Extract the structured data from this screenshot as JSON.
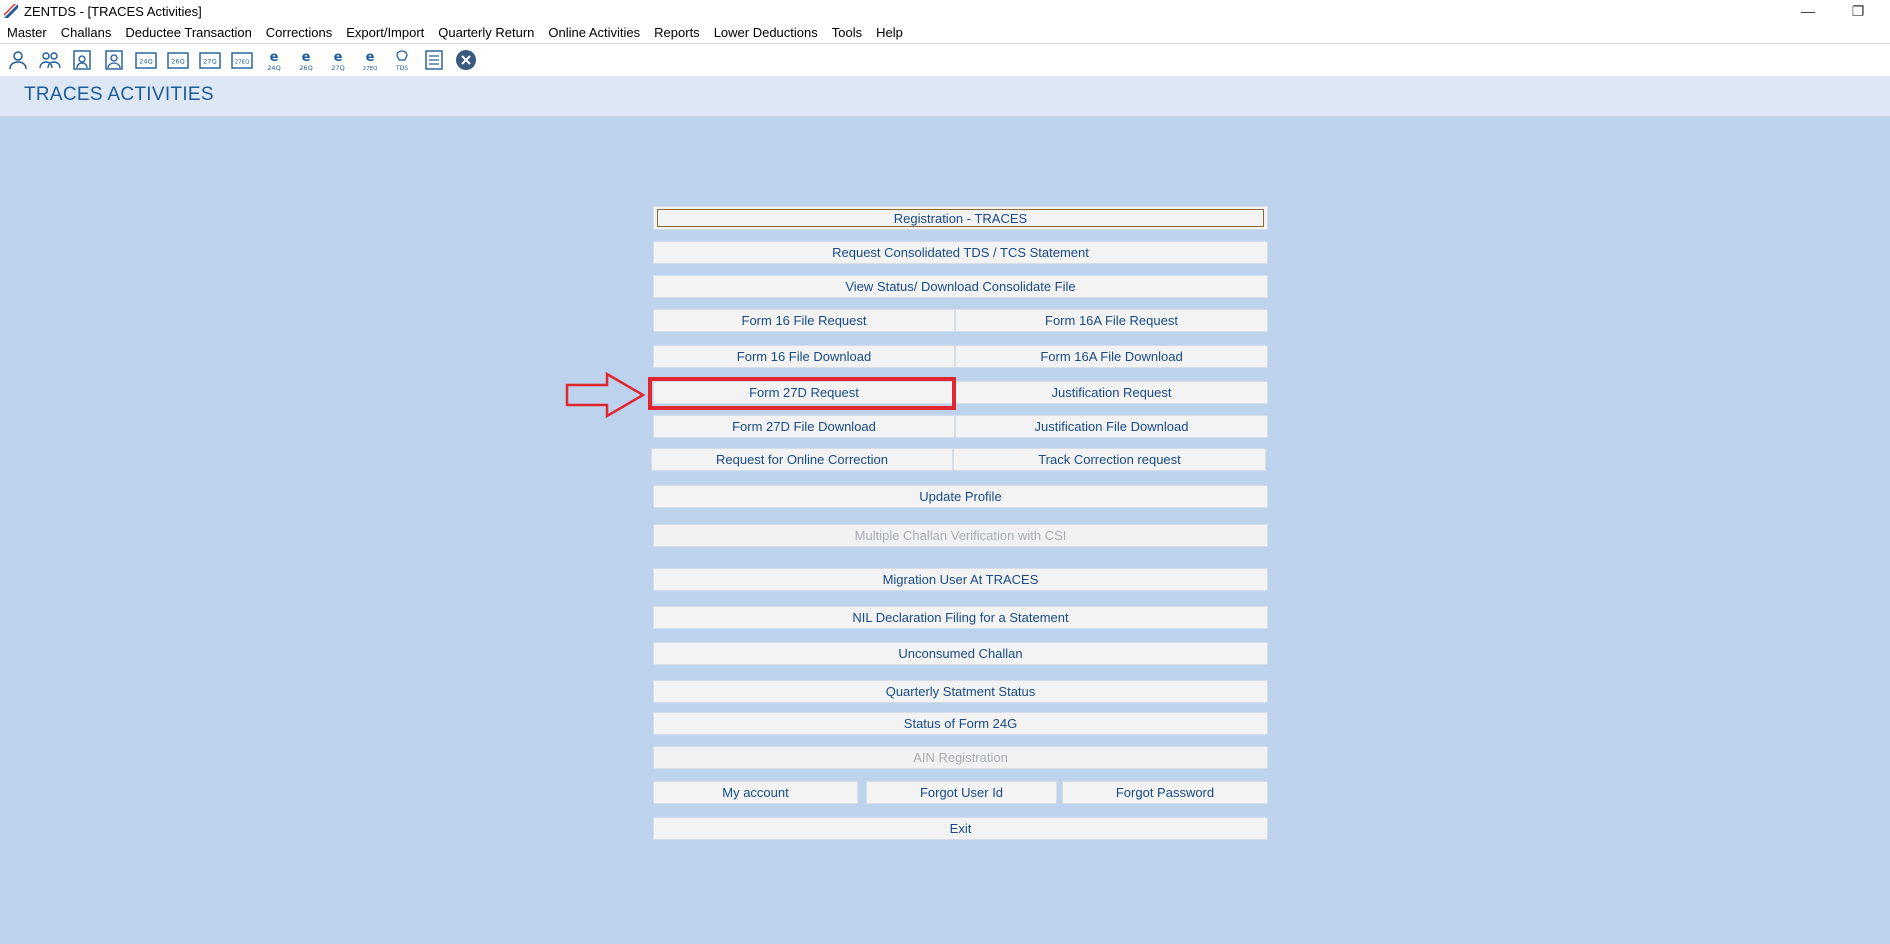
{
  "window": {
    "title": "ZENTDS - [TRACES Activities]",
    "minimize": "—",
    "restore": "❐"
  },
  "menu": [
    "Master",
    "Challans",
    "Deductee Transaction",
    "Corrections",
    "Export/Import",
    "Quarterly Return",
    "Online Activities",
    "Reports",
    "Lower Deductions",
    "Tools",
    "Help"
  ],
  "toolbar_icons": [
    "user-icon",
    "users-icon",
    "doc-user-icon",
    "doc-user2-icon",
    "form-24q-icon",
    "form-26q-icon",
    "form-27q-icon",
    "form-27eq-icon",
    "e-24q-icon",
    "e-26q-icon",
    "e-27q-icon",
    "e-27eq-icon",
    "tds-icon",
    "form-list-icon",
    "close-circle-icon"
  ],
  "toolbar_labels": {
    "tb4": "24Q",
    "tb5": "26Q",
    "tb6": "27Q",
    "tb7": "27EQ",
    "tb8": "24Q",
    "tb9": "26Q",
    "tb10": "27Q",
    "tb11": "27EQ",
    "tb12": "TDS"
  },
  "page_title": "TRACES ACTIVITIES",
  "buttons": {
    "registration": "Registration - TRACES",
    "request_consolidated": "Request Consolidated TDS / TCS Statement",
    "view_status": "View Status/ Download Consolidate File",
    "form16_request": "Form 16 File Request",
    "form16a_request": "Form 16A File Request",
    "form16_download": "Form 16 File Download",
    "form16a_download": "Form 16A File Download",
    "form27d_request": "Form 27D Request",
    "justification_request": "Justification Request",
    "form27d_download": "Form 27D File Download",
    "justification_download": "Justification File Download",
    "online_correction": "Request for Online Correction",
    "track_correction": "Track Correction request",
    "update_profile": "Update Profile",
    "multiple_challan": "Multiple Challan Verification with CSI",
    "migration_user": "Migration User At TRACES",
    "nil_declaration": "NIL Declaration Filing for a Statement",
    "unconsumed_challan": "Unconsumed Challan",
    "quarterly_status": "Quarterly Statment Status",
    "status_24g": "Status of Form 24G",
    "ain_registration": "AIN Registration",
    "my_account": "My account",
    "forgot_user_id": "Forgot User Id",
    "forgot_password": "Forgot Password",
    "exit": "Exit"
  },
  "colors": {
    "background": "#bdd2ec",
    "button_text": "#174a86",
    "highlight": "#e0262e"
  }
}
